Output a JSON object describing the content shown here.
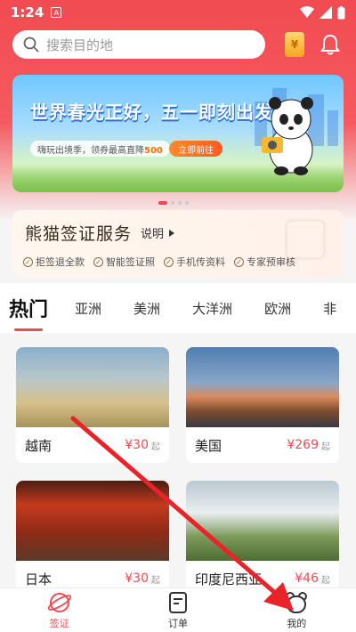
{
  "status_bar": {
    "time": "1:24",
    "a_label": "A"
  },
  "search": {
    "placeholder": "搜索目的地"
  },
  "header": {
    "wallet_label": "¥"
  },
  "banner": {
    "title": "世界春光正好，五一即刻出发",
    "subtitle_prefix": "嗨玩出境季，领券最高直降",
    "subtitle_amount": "500",
    "button_label": "立即前往"
  },
  "visa_service": {
    "title": "熊猫签证服务",
    "desc": "说明",
    "features": [
      "拒签退全款",
      "智能签证照",
      "手机传资料",
      "专家预审核"
    ]
  },
  "tabs": [
    "热门",
    "亚洲",
    "美洲",
    "大洋洲",
    "欧洲",
    "非"
  ],
  "destinations": [
    {
      "name": "越南",
      "price": "¥30",
      "suffix": "起"
    },
    {
      "name": "美国",
      "price": "¥269",
      "suffix": "起"
    },
    {
      "name": "日本",
      "price": "¥30",
      "suffix": "起"
    },
    {
      "name": "印度尼西亚",
      "price": "¥46",
      "suffix": "起"
    }
  ],
  "bottom_nav": [
    {
      "label": "签证",
      "icon": "planet-icon"
    },
    {
      "label": "订单",
      "icon": "order-icon"
    },
    {
      "label": "我的",
      "icon": "profile-bear-icon"
    }
  ],
  "colors": {
    "accent": "#f04a50",
    "header": "#f24b52"
  }
}
